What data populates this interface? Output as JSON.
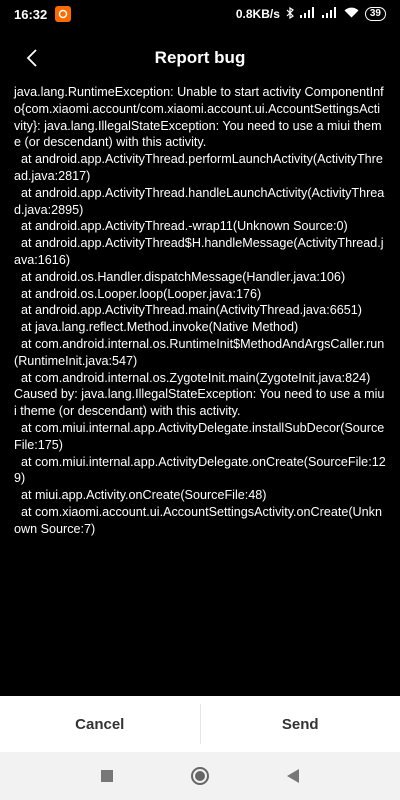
{
  "status_bar": {
    "time": "16:32",
    "net_speed": "0.8KB/s",
    "battery": "39",
    "icons": [
      "app-notification-icon",
      "bluetooth-icon",
      "signal-icon",
      "signal-icon",
      "wifi-icon",
      "battery-icon"
    ]
  },
  "header": {
    "title": "Report bug",
    "back_icon": "back-arrow-icon"
  },
  "log": {
    "text": "java.lang.RuntimeException: Unable to start activity ComponentInfo{com.xiaomi.account/com.xiaomi.account.ui.AccountSettingsActivity}: java.lang.IllegalStateException: You need to use a miui theme (or descendant) with this activity.\n  at android.app.ActivityThread.performLaunchActivity(ActivityThread.java:2817)\n  at android.app.ActivityThread.handleLaunchActivity(ActivityThread.java:2895)\n  at android.app.ActivityThread.-wrap11(Unknown Source:0)\n  at android.app.ActivityThread$H.handleMessage(ActivityThread.java:1616)\n  at android.os.Handler.dispatchMessage(Handler.java:106)\n  at android.os.Looper.loop(Looper.java:176)\n  at android.app.ActivityThread.main(ActivityThread.java:6651)\n  at java.lang.reflect.Method.invoke(Native Method)\n  at com.android.internal.os.RuntimeInit$MethodAndArgsCaller.run(RuntimeInit.java:547)\n  at com.android.internal.os.ZygoteInit.main(ZygoteInit.java:824)\nCaused by: java.lang.IllegalStateException: You need to use a miui theme (or descendant) with this activity.\n  at com.miui.internal.app.ActivityDelegate.installSubDecor(SourceFile:175)\n  at com.miui.internal.app.ActivityDelegate.onCreate(SourceFile:129)\n  at miui.app.Activity.onCreate(SourceFile:48)\n  at com.xiaomi.account.ui.AccountSettingsActivity.onCreate(Unknown Source:7)"
  },
  "actions": {
    "cancel_label": "Cancel",
    "send_label": "Send"
  },
  "nav_bar": {
    "icons": [
      "recent-apps-icon",
      "home-icon",
      "back-icon"
    ]
  },
  "colors": {
    "background": "#000000",
    "app_badge": "#ff6a00",
    "button_bar": "#ffffff"
  }
}
